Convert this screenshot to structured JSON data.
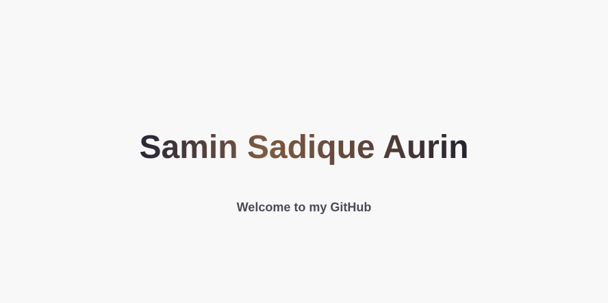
{
  "hero": {
    "title": "Samin Sadique Aurin",
    "subtitle": "Welcome to my GitHub"
  },
  "colors": {
    "background": "#f8f8f9",
    "title_gradient_start": "#252538",
    "title_gradient_middle": "#80593f",
    "title_gradient_end": "#23222f",
    "subtitle": "#4b4b57"
  }
}
